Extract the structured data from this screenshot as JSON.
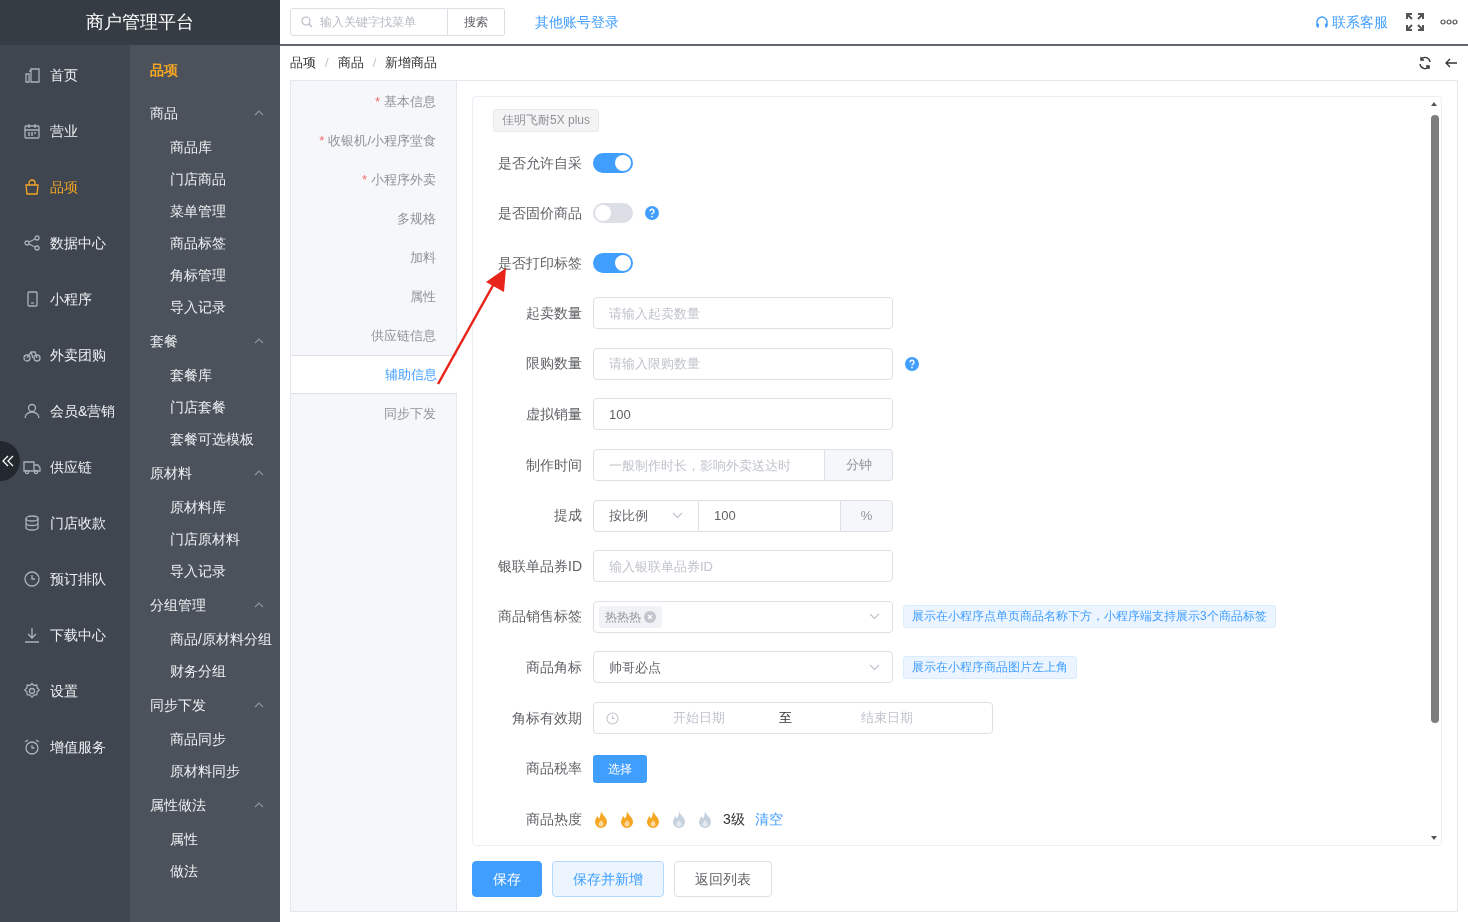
{
  "app_title": "商户管理平台",
  "nav": [
    {
      "label": "首页",
      "selected": false
    },
    {
      "label": "营业",
      "selected": false
    },
    {
      "label": "品项",
      "selected": true
    },
    {
      "label": "数据中心",
      "selected": false
    },
    {
      "label": "小程序",
      "selected": false
    },
    {
      "label": "外卖团购",
      "selected": false
    },
    {
      "label": "会员&营销",
      "selected": false
    },
    {
      "label": "供应链",
      "selected": false
    },
    {
      "label": "门店收款",
      "selected": false
    },
    {
      "label": "预订排队",
      "selected": false
    },
    {
      "label": "下载中心",
      "selected": false
    },
    {
      "label": "设置",
      "selected": false
    },
    {
      "label": "增值服务",
      "selected": false
    }
  ],
  "submenu": {
    "title": "品项",
    "groups": [
      {
        "title": "商品",
        "expanded": true,
        "items": [
          "商品库",
          "门店商品",
          "菜单管理",
          "商品标签",
          "角标管理",
          "导入记录"
        ]
      },
      {
        "title": "套餐",
        "expanded": true,
        "items": [
          "套餐库",
          "门店套餐",
          "套餐可选模板"
        ]
      },
      {
        "title": "原材料",
        "expanded": true,
        "items": [
          "原材料库",
          "门店原材料",
          "导入记录"
        ]
      },
      {
        "title": "分组管理",
        "expanded": true,
        "items": [
          "商品/原材料分组",
          "财务分组"
        ]
      },
      {
        "title": "同步下发",
        "expanded": true,
        "items": [
          "商品同步",
          "原材料同步"
        ]
      },
      {
        "title": "属性做法",
        "expanded": true,
        "items": [
          "属性",
          "做法"
        ]
      }
    ]
  },
  "topbar": {
    "search_placeholder": "输入关键字找菜单",
    "search_button": "搜索",
    "other_login": "其他账号登录",
    "support": "联系客服"
  },
  "breadcrumb": [
    "品项",
    "商品",
    "新增商品"
  ],
  "breadcrumb_separator": "/",
  "required_mark": "*",
  "section_tabs": [
    {
      "label": "基本信息",
      "required": true,
      "selected": false
    },
    {
      "label": "收银机/小程序堂食",
      "required": true,
      "selected": false
    },
    {
      "label": "小程序外卖",
      "required": true,
      "selected": false
    },
    {
      "label": "多规格",
      "required": false,
      "selected": false
    },
    {
      "label": "加料",
      "required": false,
      "selected": false
    },
    {
      "label": "属性",
      "required": false,
      "selected": false
    },
    {
      "label": "供应链信息",
      "required": false,
      "selected": false
    },
    {
      "label": "辅助信息",
      "required": false,
      "selected": true
    },
    {
      "label": "同步下发",
      "required": false,
      "selected": false
    }
  ],
  "product_tag": "佳明飞耐5X plus",
  "form": [
    {
      "kind": "toggle",
      "label": "是否允许自采",
      "on": true,
      "help": false
    },
    {
      "kind": "toggle",
      "label": "是否固价商品",
      "on": false,
      "help": true
    },
    {
      "kind": "toggle",
      "label": "是否打印标签",
      "on": true,
      "help": false
    },
    {
      "kind": "input",
      "label": "起卖数量",
      "placeholder": "请输入起卖数量",
      "help": false
    },
    {
      "kind": "input",
      "label": "限购数量",
      "placeholder": "请输入限购数量",
      "help": true
    },
    {
      "kind": "input",
      "label": "虚拟销量",
      "value": "100",
      "help": false
    },
    {
      "kind": "input_unit",
      "label": "制作时间",
      "placeholder": "一般制作时长，影响外卖送达时",
      "unit": "分钟"
    },
    {
      "kind": "select_input_unit",
      "label": "提成",
      "select_value": "按比例",
      "value": "100",
      "unit": "%"
    },
    {
      "kind": "input",
      "label": "银联单品券ID",
      "placeholder": "输入银联单品券ID",
      "help": false
    },
    {
      "kind": "select_tags",
      "label": "商品销售标签",
      "tags": [
        "热热热"
      ],
      "hint": "展示在小程序点单页商品名称下方，小程序端支持展示3个商品标签"
    },
    {
      "kind": "select",
      "label": "商品角标",
      "value": "帅哥必点",
      "hint": "展示在小程序商品图片左上角"
    },
    {
      "kind": "daterange",
      "label": "角标有效期",
      "start_placeholder": "开始日期",
      "separator": "至",
      "end_placeholder": "结束日期"
    },
    {
      "kind": "button",
      "label": "商品税率",
      "button": "选择"
    },
    {
      "kind": "flames",
      "label": "商品热度",
      "stars": 3,
      "level_text": "3级",
      "clear": "清空"
    }
  ],
  "actions": [
    {
      "label": "保存",
      "kind": "primary"
    },
    {
      "label": "保存并新增",
      "kind": "secondary"
    },
    {
      "label": "返回列表",
      "kind": "plain"
    }
  ]
}
